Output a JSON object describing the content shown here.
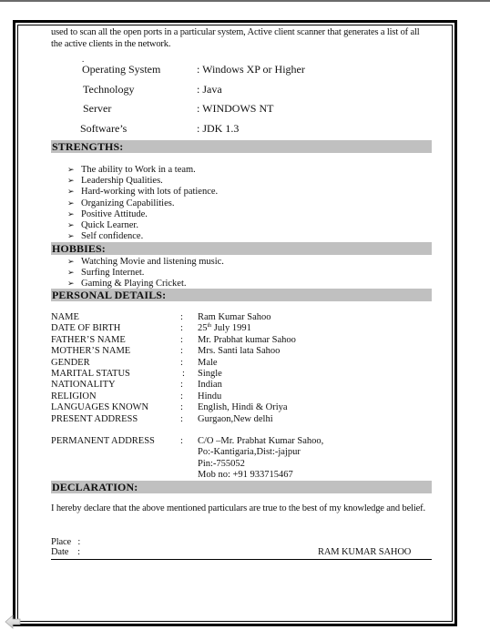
{
  "intro_text": "used to scan all the open ports in a particular system, Active client scanner that generates a list of all the active clients in the network.",
  "intro_dot": ".",
  "specs": [
    {
      "label": "Operating  System",
      "value": ": Windows XP or Higher"
    },
    {
      "label": "Technology",
      "value": ": Java"
    },
    {
      "label": "Server",
      "value": ": WINDOWS NT"
    },
    {
      "label": "Software’s",
      "value": ": JDK 1.3"
    }
  ],
  "strengths": {
    "heading": "STRENGTHS:",
    "bullet_glyph": "➢",
    "items": [
      "The ability to Work in a team.",
      "Leadership Qualities.",
      "Hard-working with lots of patience.",
      "Organizing Capabilities.",
      "Positive Attitude.",
      "Quick Learner.",
      "Self confidence."
    ]
  },
  "hobbies": {
    "heading": "HOBBIES:",
    "items": [
      "Watching Movie and listening music.",
      "Surfing Internet.",
      "Gaming & Playing Cricket."
    ]
  },
  "personal": {
    "heading": "PERSONAL DETAILS:",
    "separator": ":",
    "rows": [
      {
        "key": "NAME",
        "value": "Ram Kumar Sahoo"
      },
      {
        "key": "DATE OF BIRTH",
        "value_pre": "25",
        "value_sup": "th",
        "value_post": " July 1991"
      },
      {
        "key": "FATHER’S NAME",
        "value": "Mr. Prabhat kumar Sahoo"
      },
      {
        "key": "MOTHER’S NAME",
        "value": "Mrs. Santi lata Sahoo"
      },
      {
        "key": "GENDER",
        "value": "Male"
      },
      {
        "key": "MARITAL STATUS",
        "value": "Single"
      },
      {
        "key": "NATIONALITY",
        "value": "Indian"
      },
      {
        "key": "RELIGION",
        "value": "Hindu"
      },
      {
        "key": "LANGUAGES KNOWN",
        "value": "English, Hindi & Oriya"
      },
      {
        "key": "PRESENT ADDRESS",
        "value": "Gurgaon,New delhi"
      }
    ],
    "permanent": {
      "key": "PERMANENT ADDRESS",
      "lines": [
        "C/O –Mr. Prabhat Kumar Sahoo,",
        "Po:-Kantigaria,Dist:-jajpur",
        "Pin:-755052",
        "Mob no: +91 933715467"
      ]
    }
  },
  "declaration": {
    "heading": "DECLARATION:",
    "text": "I hereby declare that the above mentioned particulars are true to the best of my knowledge and belief.",
    "place_label": "Place   :",
    "date_label": "Date    :",
    "signature": "RAM KUMAR SAHOO"
  }
}
